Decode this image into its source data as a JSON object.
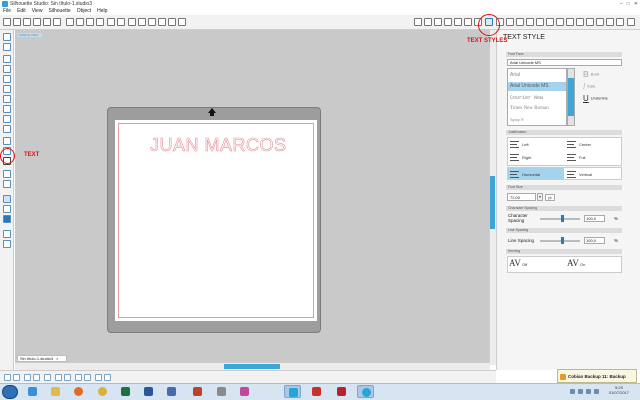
{
  "window": {
    "title": "Silhouette Studio: Sin título-1.studio3",
    "minimize": "–",
    "maximize": "□",
    "close": "✕"
  },
  "menu": [
    "File",
    "Edit",
    "View",
    "Silhouette",
    "Object",
    "Help"
  ],
  "canvas": {
    "corner_label": "SIMPLE VIEW",
    "design_text": "JUAN MARCOS",
    "doc_tab": "Sin título-1.studio3",
    "doc_tab_close": "x"
  },
  "panel": {
    "title": "TEXT STYLE",
    "font_face_section": "Font Face",
    "font_value": "Arial Unicode MS",
    "fonts": [
      "Arial",
      "Arial Unicode MS",
      "Courier New",
      "Times New Roman",
      "Spicy R"
    ],
    "selected_font_index": 1,
    "styles": {
      "bold": "Bold",
      "italic": "Italic",
      "underline": "Underline"
    },
    "justification_section": "Justification",
    "justification": [
      "Left",
      "Center",
      "Right",
      "Full"
    ],
    "direction": {
      "horizontal": "Horizontal",
      "vertical": "Vertical"
    },
    "font_size_section": "Font Size",
    "font_size": "72,00",
    "font_size_unit": "pt",
    "char_spacing_section": "Character Spacing",
    "char_spacing_label": "Character Spacing",
    "char_spacing_value": "100,0",
    "line_spacing_section": "Line Spacing",
    "line_spacing_label": "Line Spacing",
    "line_spacing_value": "100,0",
    "percent": "%",
    "kerning_section": "Kerning",
    "kerning": {
      "off": "Off",
      "on": "On",
      "glyph": "AV"
    }
  },
  "annotations": {
    "text_styles": "TEXT STYLES",
    "text": "TEXT"
  },
  "notification": "Cobian Backup 11: Backup done",
  "clock": {
    "time": "5:29",
    "date": "01/07/2017"
  },
  "colors": {
    "accent": "#3aa7d6",
    "annotation": "#d51414",
    "selection": "#a5d3ee"
  }
}
